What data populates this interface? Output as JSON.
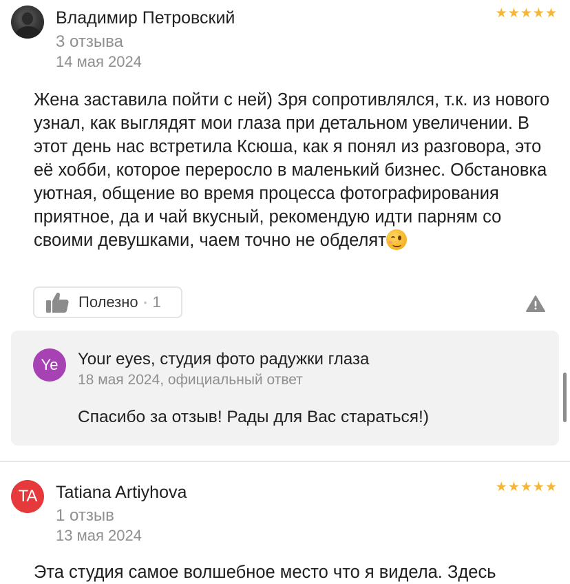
{
  "review1": {
    "author": "Владимир Петровский",
    "reviews_count": "3 отзыва",
    "date": "14 мая 2024",
    "rating": 5,
    "text": "Жена заставила пойти с ней) Зря сопротивлялся, т.к. из нового узнал, как выглядят мои глаза при детальном увеличении. В этот день нас встретила Ксюша, как я понял из разговора, это её хобби, которое переросло в маленький бизнес. Обстановка уютная, общение во время процесса фотографирования приятное, да и чай вкусный, рекомендую идти парням со своими девушками, чаем точно не обделят",
    "useful_label": "Полезно",
    "useful_count": "1",
    "reply": {
      "avatar_initials": "Ye",
      "author": "Your eyes, студия фото радужки глаза",
      "meta": "18 мая 2024, официальный ответ",
      "text": "Спасибо за отзыв! Рады для Вас стараться!)"
    }
  },
  "review2": {
    "avatar_initials": "TA",
    "author": "Tatiana Artiyhova",
    "reviews_count": "1 отзыв",
    "date": "13 мая 2024",
    "rating": 5,
    "text_preview": "Эта студия самое волшебное место что я видела. Здесь"
  },
  "colors": {
    "star": "#f6b631",
    "reply_avatar": "#a742b5",
    "initials_avatar": "#e5393b",
    "reply_background": "#f2f2f2"
  },
  "icons": {
    "useful": "thumbs-up-icon",
    "report": "warning-triangle-icon",
    "rating": "star-icon"
  }
}
